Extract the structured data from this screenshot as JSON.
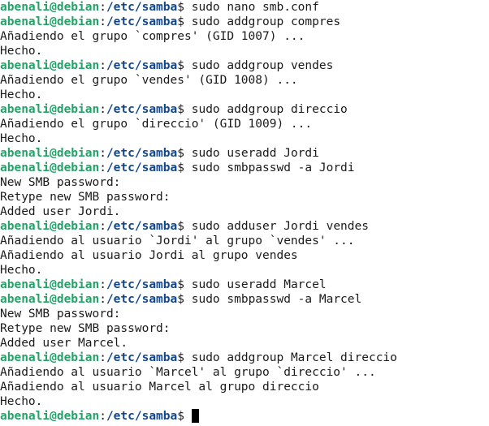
{
  "terminal": {
    "prompt": {
      "user_host": "abenali@debian",
      "separator": ":",
      "path": "/etc/samba",
      "suffix": "$ "
    },
    "lines": [
      {
        "type": "prompt",
        "cmd": "sudo nano smb.conf"
      },
      {
        "type": "prompt",
        "cmd": "sudo addgroup compres"
      },
      {
        "type": "output",
        "text": "Añadiendo el grupo `compres' (GID 1007) ..."
      },
      {
        "type": "output",
        "text": "Hecho."
      },
      {
        "type": "prompt",
        "cmd": "sudo addgroup vendes"
      },
      {
        "type": "output",
        "text": "Añadiendo el grupo `vendes' (GID 1008) ..."
      },
      {
        "type": "output",
        "text": "Hecho."
      },
      {
        "type": "prompt",
        "cmd": "sudo addgroup direccio"
      },
      {
        "type": "output",
        "text": "Añadiendo el grupo `direccio' (GID 1009) ..."
      },
      {
        "type": "output",
        "text": "Hecho."
      },
      {
        "type": "prompt",
        "cmd": "sudo useradd Jordi"
      },
      {
        "type": "prompt",
        "cmd": "sudo smbpasswd -a Jordi"
      },
      {
        "type": "output",
        "text": "New SMB password:"
      },
      {
        "type": "output",
        "text": "Retype new SMB password:"
      },
      {
        "type": "output",
        "text": "Added user Jordi."
      },
      {
        "type": "prompt",
        "cmd": "sudo adduser Jordi vendes"
      },
      {
        "type": "output",
        "text": "Añadiendo al usuario `Jordi' al grupo `vendes' ..."
      },
      {
        "type": "output",
        "text": "Añadiendo al usuario Jordi al grupo vendes"
      },
      {
        "type": "output",
        "text": "Hecho."
      },
      {
        "type": "prompt",
        "cmd": "sudo useradd Marcel"
      },
      {
        "type": "prompt",
        "cmd": "sudo smbpasswd -a Marcel"
      },
      {
        "type": "output",
        "text": "New SMB password:"
      },
      {
        "type": "output",
        "text": "Retype new SMB password:"
      },
      {
        "type": "output",
        "text": "Added user Marcel."
      },
      {
        "type": "prompt",
        "cmd": "sudo addgroup Marcel direccio"
      },
      {
        "type": "output",
        "text": "Añadiendo al usuario `Marcel' al grupo `direccio' ..."
      },
      {
        "type": "output",
        "text": "Añadiendo al usuario Marcel al grupo direccio"
      },
      {
        "type": "output",
        "text": "Hecho."
      },
      {
        "type": "prompt",
        "cmd": "",
        "cursor": true
      }
    ],
    "colors": {
      "user_host": "#26a269",
      "path": "#12488b",
      "text": "#1a1a1a",
      "background": "#ffffff",
      "cursor": "#000000"
    }
  }
}
